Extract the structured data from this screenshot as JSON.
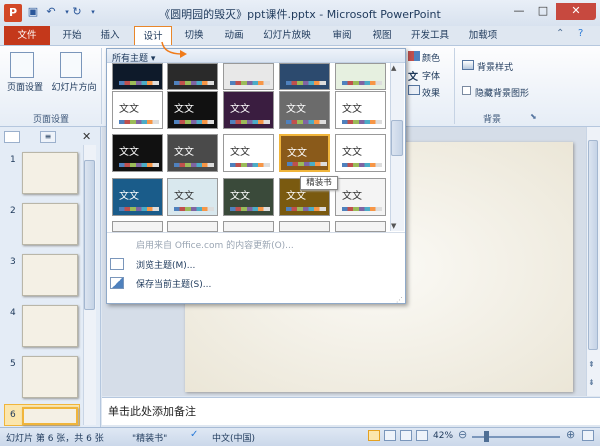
{
  "titlebar": {
    "app_icon": "P",
    "title": "《圆明园的毁灭》ppt课件.pptx - Microsoft PowerPoint",
    "minimize": "—",
    "maximize": "□",
    "close": "✕"
  },
  "tabs": [
    "文件",
    "开始",
    "插入",
    "设计",
    "切换",
    "动画",
    "幻灯片放映",
    "审阅",
    "视图",
    "开发工具",
    "加载项"
  ],
  "ribbon": {
    "page_setup": "页面设置",
    "slide_orientation": "幻灯片方向",
    "group_page_setup": "页面设置",
    "colors": "颜色",
    "fonts": "字体",
    "effects": "效果",
    "background_styles": "背景样式",
    "hide_background": "隐藏背景图形",
    "group_background": "背景"
  },
  "gallery": {
    "header": "所有主题",
    "tooltip": "精装书",
    "theme_label": "文文",
    "menu_update": "启用来自 Office.com 的内容更新(O)...",
    "menu_browse": "浏览主题(M)...",
    "menu_save": "保存当前主题(S)..."
  },
  "slides": [
    "1",
    "2",
    "3",
    "4",
    "5",
    "6"
  ],
  "notes_placeholder": "单击此处添加备注",
  "status": {
    "slide_info": "幻灯片 第 6 张，共 6 张",
    "theme_name": "\"精装书\"",
    "language": "中文(中国)",
    "zoom": "42%"
  }
}
